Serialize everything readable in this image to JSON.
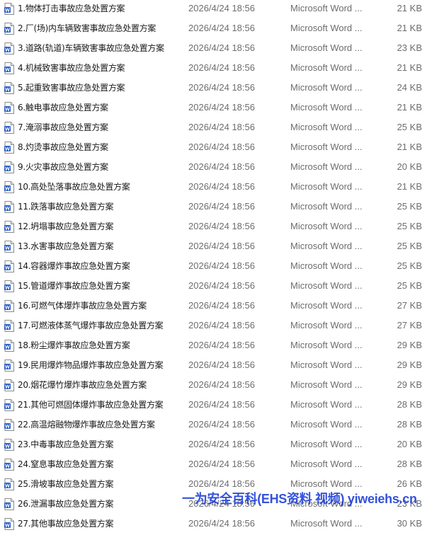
{
  "file_icon": "word-document-icon",
  "files": [
    {
      "name": "1.物体打击事故应急处置方案",
      "date": "2026/4/24 18:56",
      "type": "Microsoft Word ...",
      "size": "21 KB"
    },
    {
      "name": "2.厂(场)内车辆致害事故应急处置方案",
      "date": "2026/4/24 18:56",
      "type": "Microsoft Word ...",
      "size": "21 KB"
    },
    {
      "name": "3.道路(轨道)车辆致害事故应急处置方案",
      "date": "2026/4/24 18:56",
      "type": "Microsoft Word ...",
      "size": "23 KB"
    },
    {
      "name": "4.机械致害事故应急处置方案",
      "date": "2026/4/24 18:56",
      "type": "Microsoft Word ...",
      "size": "21 KB"
    },
    {
      "name": "5.起重致害事故应急处置方案",
      "date": "2026/4/24 18:56",
      "type": "Microsoft Word ...",
      "size": "24 KB"
    },
    {
      "name": "6.触电事故应急处置方案",
      "date": "2026/4/24 18:56",
      "type": "Microsoft Word ...",
      "size": "21 KB"
    },
    {
      "name": "7.淹溺事故应急处置方案",
      "date": "2026/4/24 18:56",
      "type": "Microsoft Word ...",
      "size": "25 KB"
    },
    {
      "name": "8.灼烫事故应急处置方案",
      "date": "2026/4/24 18:56",
      "type": "Microsoft Word ...",
      "size": "21 KB"
    },
    {
      "name": "9.火灾事故应急处置方案",
      "date": "2026/4/24 18:56",
      "type": "Microsoft Word ...",
      "size": "20 KB"
    },
    {
      "name": "10.高处坠落事故应急处置方案",
      "date": "2026/4/24 18:56",
      "type": "Microsoft Word ...",
      "size": "21 KB"
    },
    {
      "name": "11.跌落事故应急处置方案",
      "date": "2026/4/24 18:56",
      "type": "Microsoft Word ...",
      "size": "25 KB"
    },
    {
      "name": "12.坍塌事故应急处置方案",
      "date": "2026/4/24 18:56",
      "type": "Microsoft Word ...",
      "size": "25 KB"
    },
    {
      "name": "13.水害事故应急处置方案",
      "date": "2026/4/24 18:56",
      "type": "Microsoft Word ...",
      "size": "25 KB"
    },
    {
      "name": "14.容器爆炸事故应急处置方案",
      "date": "2026/4/24 18:56",
      "type": "Microsoft Word ...",
      "size": "25 KB"
    },
    {
      "name": "15.管道爆炸事故应急处置方案",
      "date": "2026/4/24 18:56",
      "type": "Microsoft Word ...",
      "size": "25 KB"
    },
    {
      "name": "16.可燃气体爆炸事故应急处置方案",
      "date": "2026/4/24 18:56",
      "type": "Microsoft Word ...",
      "size": "27 KB"
    },
    {
      "name": "17.可燃液体蒸气爆炸事故应急处置方案",
      "date": "2026/4/24 18:56",
      "type": "Microsoft Word ...",
      "size": "27 KB"
    },
    {
      "name": "18.粉尘爆炸事故应急处置方案",
      "date": "2026/4/24 18:56",
      "type": "Microsoft Word ...",
      "size": "29 KB"
    },
    {
      "name": "19.民用爆炸物品爆炸事故应急处置方案",
      "date": "2026/4/24 18:56",
      "type": "Microsoft Word ...",
      "size": "29 KB"
    },
    {
      "name": "20.烟花爆竹爆炸事故应急处置方案",
      "date": "2026/4/24 18:56",
      "type": "Microsoft Word ...",
      "size": "29 KB"
    },
    {
      "name": "21.其他可燃固体爆炸事故应急处置方案",
      "date": "2026/4/24 18:56",
      "type": "Microsoft Word ...",
      "size": "28 KB"
    },
    {
      "name": "22.高温熔融物爆炸事故应急处置方案",
      "date": "2026/4/24 18:56",
      "type": "Microsoft Word ...",
      "size": "28 KB"
    },
    {
      "name": "23.中毒事故应急处置方案",
      "date": "2026/4/24 18:56",
      "type": "Microsoft Word ...",
      "size": "20 KB"
    },
    {
      "name": "24.窒息事故应急处置方案",
      "date": "2026/4/24 18:56",
      "type": "Microsoft Word ...",
      "size": "28 KB"
    },
    {
      "name": "25.滑坡事故应急处置方案",
      "date": "2026/4/24 18:56",
      "type": "Microsoft Word ...",
      "size": "26 KB"
    },
    {
      "name": "26.泄漏事故应急处置方案",
      "date": "2026/4/24 18:56",
      "type": "Microsoft Word ...",
      "size": "23 KB"
    },
    {
      "name": "27.其他事故应急处置方案",
      "date": "2026/4/24 18:56",
      "type": "Microsoft Word ...",
      "size": "30 KB"
    }
  ],
  "watermark": {
    "text": "一为安全百科(EHS资料 视频) yiweiehs.cn",
    "color": "#1e3fd8"
  }
}
